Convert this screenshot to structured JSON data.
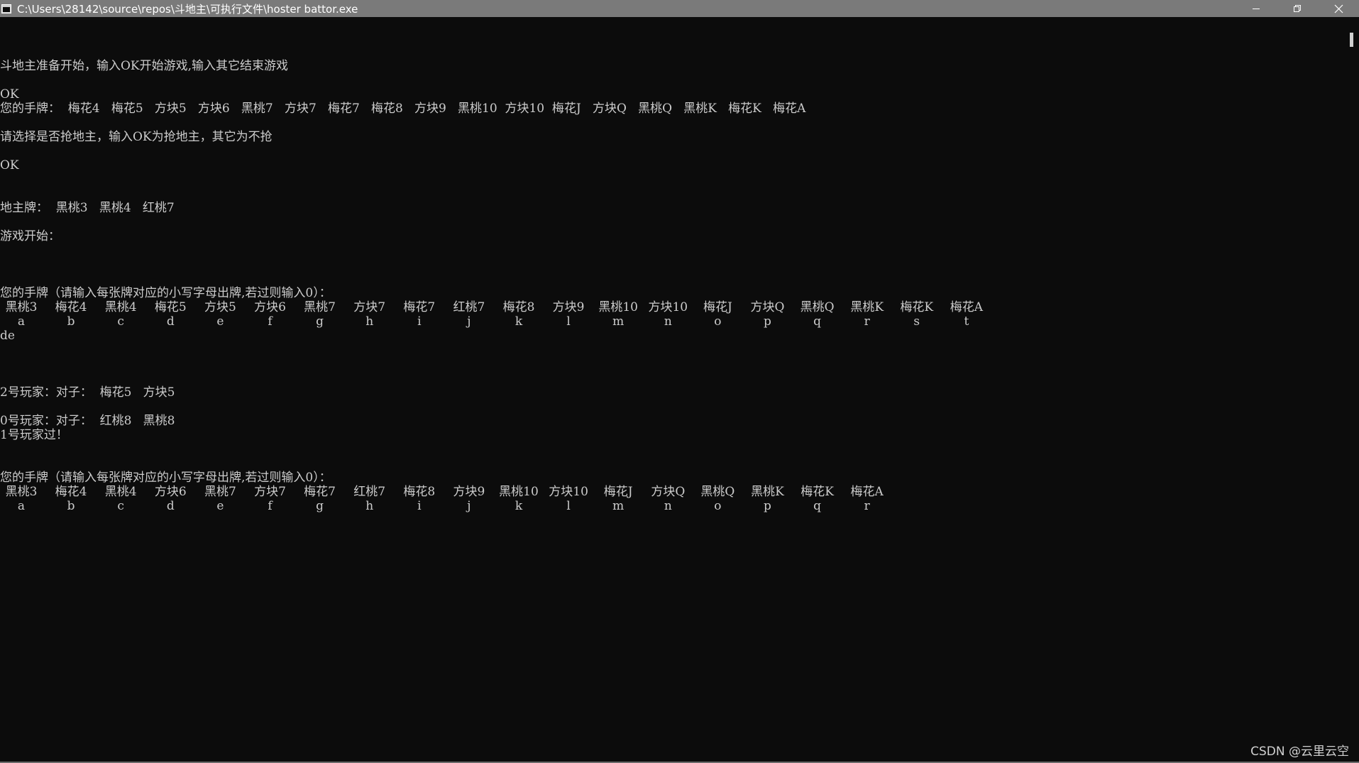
{
  "window": {
    "title": "C:\\Users\\28142\\source\\repos\\斗地主\\可执行文件\\hoster battor.exe"
  },
  "console": {
    "line_start": "斗地主准备开始，输入OK开始游戏,输入其它结束游戏",
    "input_ok_1": "OK",
    "hand_initial": "您的手牌：  梅花4   梅花5   方块5   方块6   黑桃7   方块7   梅花7   梅花8   方块9   黑桃10  方块10  梅花J   方块Q   黑桃Q   黑桃K   梅花K   梅花A",
    "line_grab": "请选择是否抢地主，输入OK为抢地主，其它为不抢",
    "input_ok_2": "OK",
    "landlord_cards": "地主牌：  黑桃3   黑桃4   红桃7",
    "game_start": "游戏开始：",
    "hand_prompt_1": "您的手牌（请输入每张牌对应的小写字母出牌,若过则输入0）：",
    "hand_1": {
      "cards": [
        "黑桃3",
        "梅花4",
        "黑桃4",
        "梅花5",
        "方块5",
        "方块6",
        "黑桃7",
        "方块7",
        "梅花7",
        "红桃7",
        "梅花8",
        "方块9",
        "黑桃10",
        "方块10",
        "梅花J",
        "方块Q",
        "黑桃Q",
        "黑桃K",
        "梅花K",
        "梅花A"
      ],
      "letters": [
        "a",
        "b",
        "c",
        "d",
        "e",
        "f",
        "g",
        "h",
        "i",
        "j",
        "k",
        "l",
        "m",
        "n",
        "o",
        "p",
        "q",
        "r",
        "s",
        "t"
      ]
    },
    "input_de": "de",
    "player2_play": "2号玩家：对子：  梅花5   方块5",
    "player0_play": "0号玩家：对子：  红桃8   黑桃8",
    "player1_pass": "1号玩家过！",
    "hand_prompt_2": "您的手牌（请输入每张牌对应的小写字母出牌,若过则输入0）：",
    "hand_2": {
      "cards": [
        "黑桃3",
        "梅花4",
        "黑桃4",
        "方块6",
        "黑桃7",
        "方块7",
        "梅花7",
        "红桃7",
        "梅花8",
        "方块9",
        "黑桃10",
        "方块10",
        "梅花J",
        "方块Q",
        "黑桃Q",
        "黑桃K",
        "梅花K",
        "梅花A"
      ],
      "letters": [
        "a",
        "b",
        "c",
        "d",
        "e",
        "f",
        "g",
        "h",
        "i",
        "j",
        "k",
        "l",
        "m",
        "n",
        "o",
        "p",
        "q",
        "r"
      ]
    }
  },
  "watermark": "CSDN @云里云空",
  "colors": {
    "background": "#0c0c0c",
    "text": "#cccccc",
    "titlebar": "#7a7a7a"
  },
  "icons": [
    "console-app-icon",
    "minimize-icon",
    "restore-icon",
    "close-icon"
  ]
}
